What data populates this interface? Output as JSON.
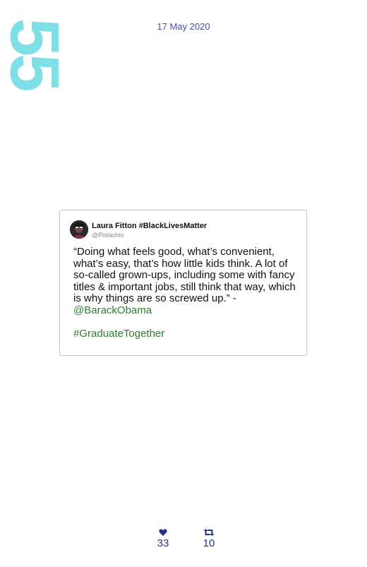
{
  "day_number": "55",
  "date": "17 May 2020",
  "tweet": {
    "author_name": "Laura Fitton #BlackLivesMatter",
    "author_handle": "@Pistachio",
    "body_text": "“Doing what feels good, what’s convenient, what’s easy, that’s how little kids think. A lot of so-called grown-ups, including some with fancy titles & important jobs, still think that way, which is why things are so screwed up.” -",
    "mention": "@BarackObama",
    "hashtag": "#GraduateTogether"
  },
  "stats": {
    "likes": "33",
    "retweets": "10"
  },
  "colors": {
    "accent_cyan": "#7fdfe6",
    "date_text": "#4b4db3",
    "link_green": "#2e7d32",
    "stat_blue": "#24308a"
  },
  "icons": {
    "likes": "heart-icon",
    "retweets": "retweet-icon"
  }
}
